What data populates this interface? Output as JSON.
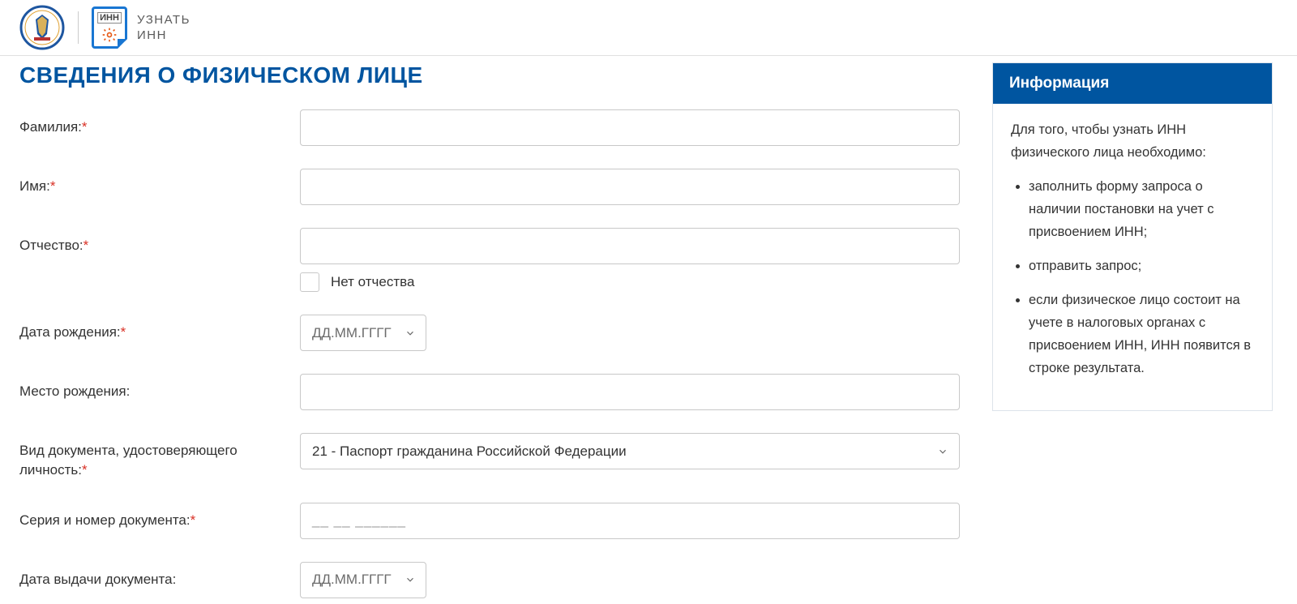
{
  "header": {
    "inn_icon_text": "ИНН",
    "title_line1": "УЗНАТЬ",
    "title_line2": "ИНН"
  },
  "page": {
    "title": "СВЕДЕНИЯ О ФИЗИЧЕСКОМ ЛИЦЕ"
  },
  "form": {
    "surname_label": "Фамилия:",
    "name_label": "Имя:",
    "patronymic_label": "Отчество:",
    "no_patronymic_label": "Нет отчества",
    "dob_label": "Дата рождения:",
    "date_placeholder": "ДД.ММ.ГГГГ",
    "birthplace_label": "Место рождения:",
    "doc_type_label": "Вид документа, удостоверяющего личность:",
    "doc_type_value": "21 - Паспорт гражданина Российской Федерации",
    "doc_number_label": "Серия и номер документа:",
    "doc_number_mask": "__ __ ______",
    "doc_issue_date_label": "Дата выдачи документа:"
  },
  "sidebar": {
    "info_title": "Информация",
    "info_intro": "Для того, чтобы узнать ИНН физического лица необходимо:",
    "bullets": [
      "заполнить форму запроса о наличии постановки на учет с присвоением ИНН;",
      "отправить запрос;",
      "если физическое лицо состоит на учете в налоговых органах с присвоением ИНН, ИНН появится в строке результата."
    ]
  }
}
